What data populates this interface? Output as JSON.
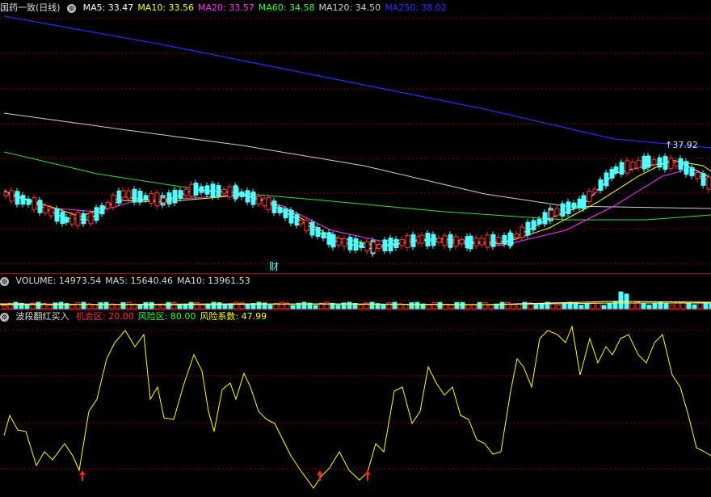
{
  "price": {
    "title": "国药一致(日线)",
    "indicators": [
      {
        "label": "MA5: 33.47",
        "color": "#ffffff"
      },
      {
        "label": "MA10: 33.56",
        "color": "#ffff00"
      },
      {
        "label": "MA20: 33.57",
        "color": "#ff33ff"
      },
      {
        "label": "MA60: 34.58",
        "color": "#33ff33"
      },
      {
        "label": "MA120: 34.50",
        "color": "#d0d0d0"
      },
      {
        "label": "MA250: 38.02",
        "color": "#3333ff"
      }
    ],
    "high_label": "37.92",
    "marker_label": "财"
  },
  "volume": {
    "indicators": [
      {
        "label": "VOLUME: 14973.54",
        "color": "#dddddd"
      },
      {
        "label": "MA5: 15640.46",
        "color": "#dddddd"
      },
      {
        "label": "MA10: 13961.53",
        "color": "#dddddd"
      }
    ]
  },
  "osc": {
    "title": "波段翻红买入",
    "indicators": [
      {
        "label": "机会区: 20.00",
        "color": "#ff3333"
      },
      {
        "label": "风险区: 80.00",
        "color": "#33ff33"
      },
      {
        "label": "风险系数: 47.99",
        "color": "#ffff00"
      }
    ]
  },
  "colors": {
    "up": "#ff3333",
    "down": "#54ffff",
    "grid": "#8b0000",
    "bg": "#000000"
  }
}
